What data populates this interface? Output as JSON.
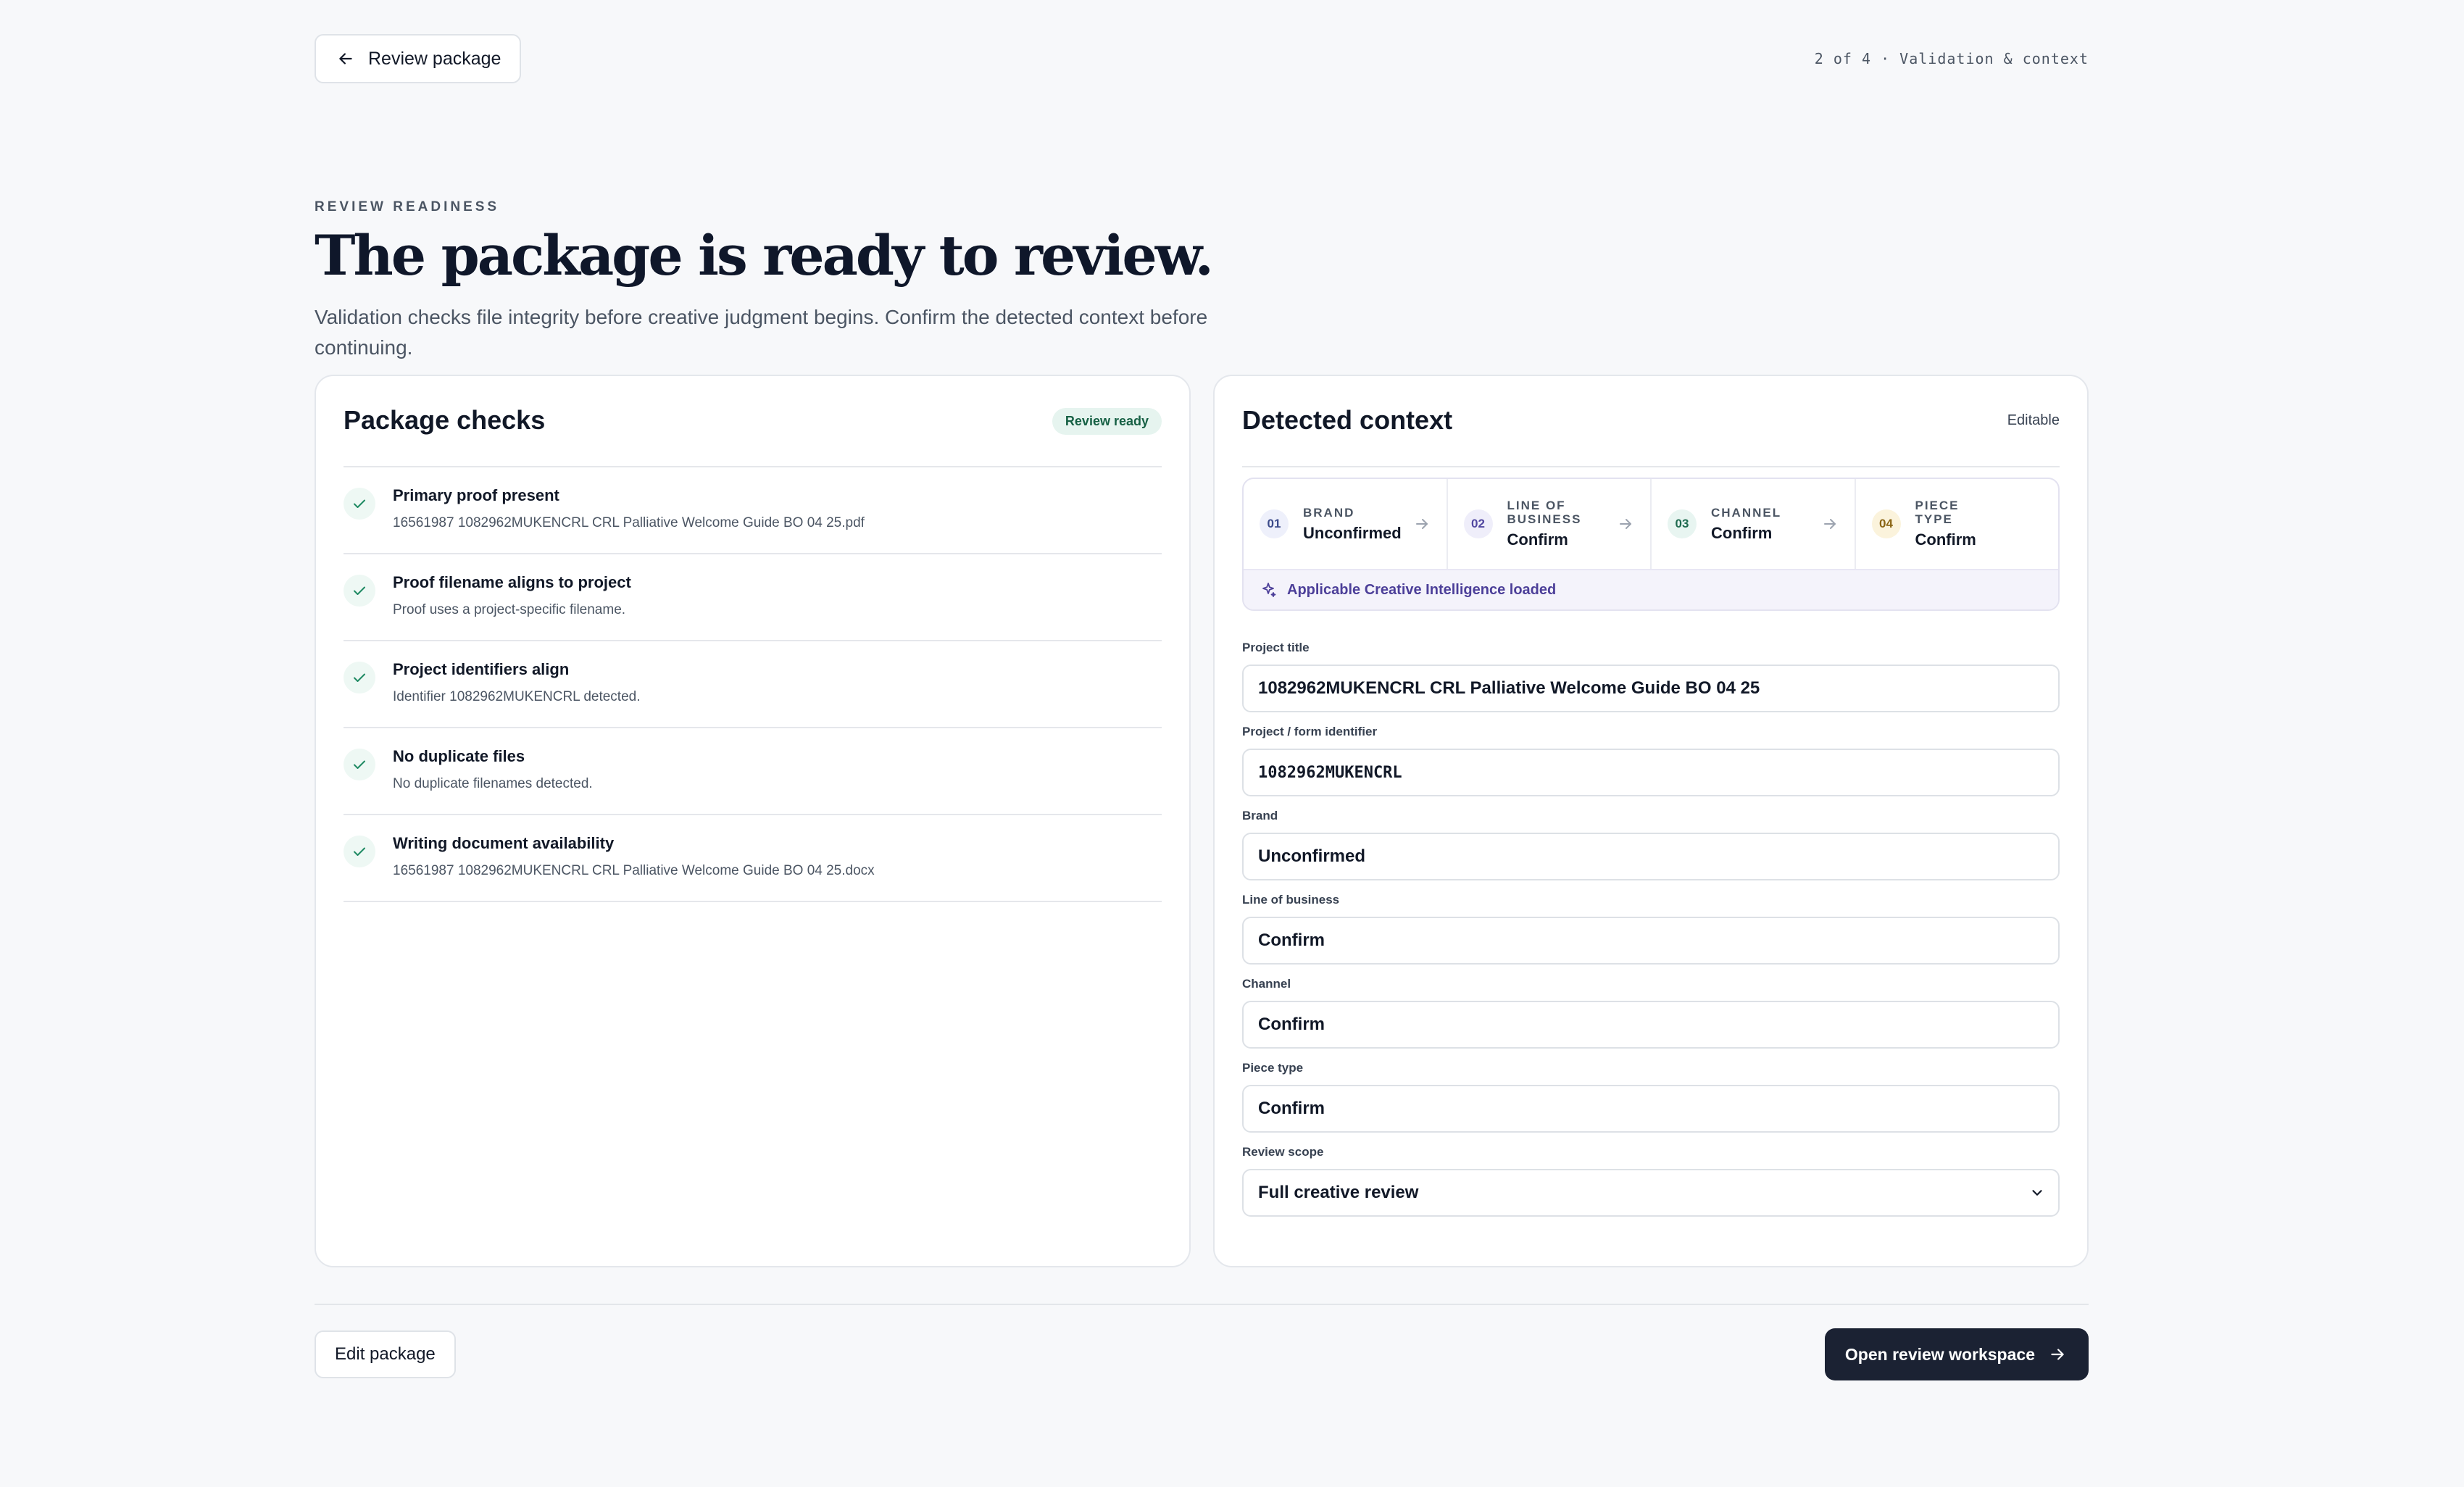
{
  "header": {
    "back_label": "Review package",
    "step_indicator": "2 of 4 · Validation & context"
  },
  "hero": {
    "eyebrow": "REVIEW READINESS",
    "title": "The package is ready to review.",
    "subtitle": "Validation checks file integrity before creative judgment begins. Confirm the detected context before continuing."
  },
  "package_checks": {
    "title": "Package checks",
    "badge": "Review ready",
    "items": [
      {
        "title": "Primary proof present",
        "detail": "16561987 1082962MUKENCRL CRL Palliative Welcome Guide BO 04 25.pdf"
      },
      {
        "title": "Proof filename aligns to project",
        "detail": "Proof uses a project-specific filename."
      },
      {
        "title": "Project identifiers align",
        "detail": "Identifier 1082962MUKENCRL detected."
      },
      {
        "title": "No duplicate files",
        "detail": "No duplicate filenames detected."
      },
      {
        "title": "Writing document availability",
        "detail": "16561987 1082962MUKENCRL CRL Palliative Welcome Guide BO 04 25.docx"
      }
    ]
  },
  "detected_context": {
    "title": "Detected context",
    "badge": "Editable",
    "steps": [
      {
        "num": "01",
        "label": "BRAND",
        "value": "Unconfirmed"
      },
      {
        "num": "02",
        "label": "LINE OF BUSINESS",
        "value": "Confirm"
      },
      {
        "num": "03",
        "label": "CHANNEL",
        "value": "Confirm"
      },
      {
        "num": "04",
        "label": "PIECE TYPE",
        "value": "Confirm"
      }
    ],
    "ci_message": "Applicable Creative Intelligence loaded",
    "fields": {
      "project_title": {
        "label": "Project title",
        "value": "1082962MUKENCRL CRL Palliative Welcome Guide BO 04 25"
      },
      "project_identifier": {
        "label": "Project / form identifier",
        "value": "1082962MUKENCRL"
      },
      "brand": {
        "label": "Brand",
        "value": "Unconfirmed"
      },
      "line_of_business": {
        "label": "Line of business",
        "value": "Confirm"
      },
      "channel": {
        "label": "Channel",
        "value": "Confirm"
      },
      "piece_type": {
        "label": "Piece type",
        "value": "Confirm"
      },
      "review_scope": {
        "label": "Review scope",
        "value": "Full creative review"
      }
    }
  },
  "footer": {
    "edit_label": "Edit package",
    "open_label": "Open review workspace"
  },
  "colors": {
    "primary_button": "#1b2233",
    "success_badge_bg": "#e6f4ef",
    "success_badge_text": "#166044",
    "ci_text": "#4c3f99"
  }
}
